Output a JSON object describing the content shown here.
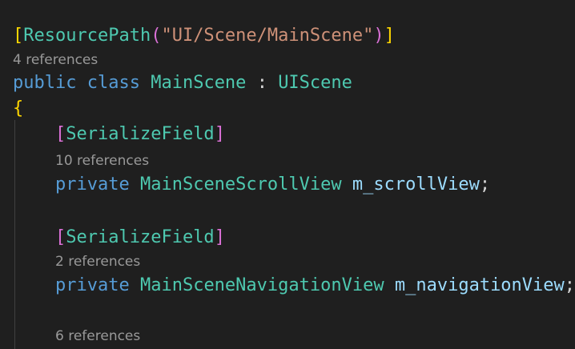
{
  "editor": {
    "colors": {
      "background": "#1f1f1f",
      "keyword": "#569cd6",
      "type": "#4ec9b0",
      "string": "#ce9178",
      "field": "#9cdcfe",
      "codelens": "#999999",
      "bracket_level1": "#ffd700",
      "bracket_level2": "#da70d6"
    },
    "attribute": {
      "name": "ResourcePath",
      "arg": "\"UI/Scene/MainScene\""
    },
    "class_lens": "4 references",
    "class_decl": {
      "kw1": "public",
      "kw2": "class",
      "name": "MainScene",
      "colon": ":",
      "base": "UIScene"
    },
    "open_brace": "{",
    "fields": [
      {
        "attribute": "SerializeField",
        "lens": "10 references",
        "kw": "private",
        "type": "MainSceneScrollView",
        "name": "m_scrollView",
        "semi": ";"
      },
      {
        "attribute": "SerializeField",
        "lens": "2 references",
        "kw": "private",
        "type": "MainSceneNavigationView",
        "name": "m_navigationView",
        "semi": ";"
      }
    ],
    "last_lens": "6 references"
  }
}
